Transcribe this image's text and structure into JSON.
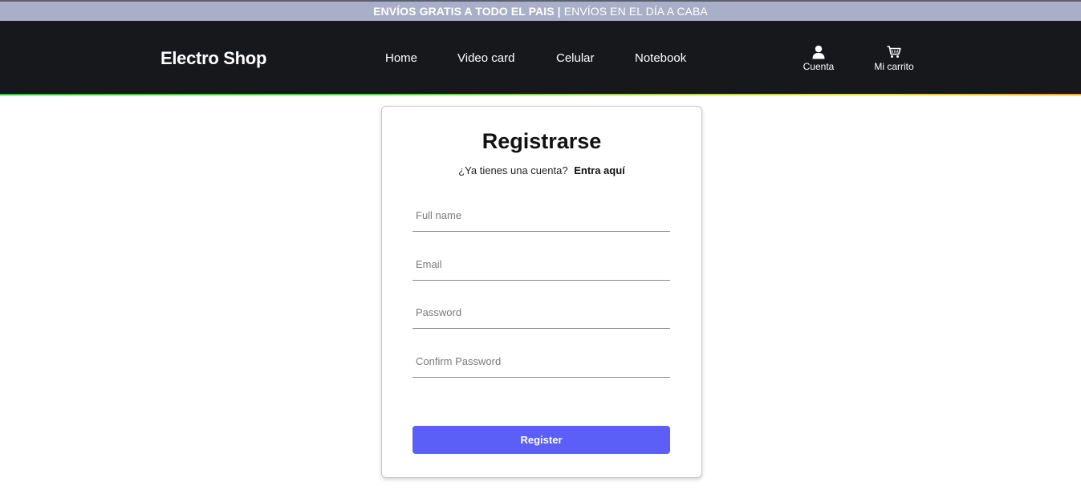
{
  "promo": {
    "bold_text": "ENVÍOS GRATIS A TODO EL PAIS",
    "separator": "|",
    "regular_text": "ENVÍOS EN EL DÍA A CABA"
  },
  "header": {
    "logo": "Electro Shop",
    "nav": [
      "Home",
      "Video card",
      "Celular",
      "Notebook"
    ],
    "account_label": "Cuenta",
    "account_icon": "user-icon",
    "cart_label": "Mi carrito",
    "cart_icon": "shopping-cart-icon"
  },
  "form": {
    "title": "Registrarse",
    "login_prompt": "¿Ya tienes una cuenta?",
    "login_link": "Entra aquí",
    "fields": {
      "full_name": {
        "placeholder": "Full name",
        "value": ""
      },
      "email": {
        "placeholder": "Email",
        "value": ""
      },
      "password": {
        "placeholder": "Password",
        "value": ""
      },
      "confirm_password": {
        "placeholder": "Confirm Password",
        "value": ""
      }
    },
    "submit_label": "Register"
  },
  "colors": {
    "header_bg": "#17181c",
    "promo_bg": "#a9afc6",
    "button_bg": "#5b5ef7"
  }
}
